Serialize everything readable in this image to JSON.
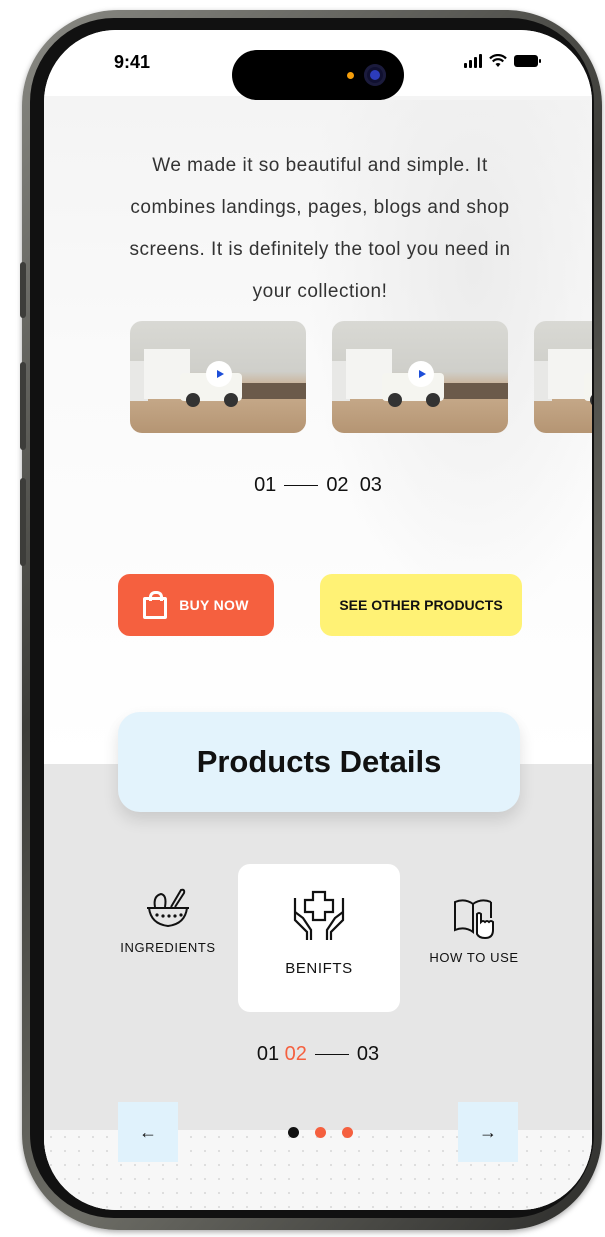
{
  "status": {
    "time": "9:41"
  },
  "hero": {
    "description": "We made it so beautiful and simple. It combines landings, pages, blogs and shop screens. It is definitely the tool you need in your collection!",
    "pager": {
      "current": "01",
      "next": "02",
      "last": "03"
    }
  },
  "actions": {
    "buy_label": "BUY NOW",
    "other_label": "SEE OTHER PRODUCTS"
  },
  "details": {
    "title": "Products Details",
    "tabs": [
      {
        "label": "INGREDIENTS",
        "icon": "mortar-bowl-icon"
      },
      {
        "label": "BENIFTS",
        "icon": "hands-medical-cross-icon"
      },
      {
        "label": "HOW TO USE",
        "icon": "book-hand-icon"
      }
    ],
    "pager": {
      "first": "01",
      "current": "02",
      "last": "03"
    }
  },
  "nav": {
    "prev": "←",
    "next": "→"
  },
  "colors": {
    "accent": "#f5603f",
    "yellow": "#fff275",
    "light_blue": "#e3f3fc"
  }
}
